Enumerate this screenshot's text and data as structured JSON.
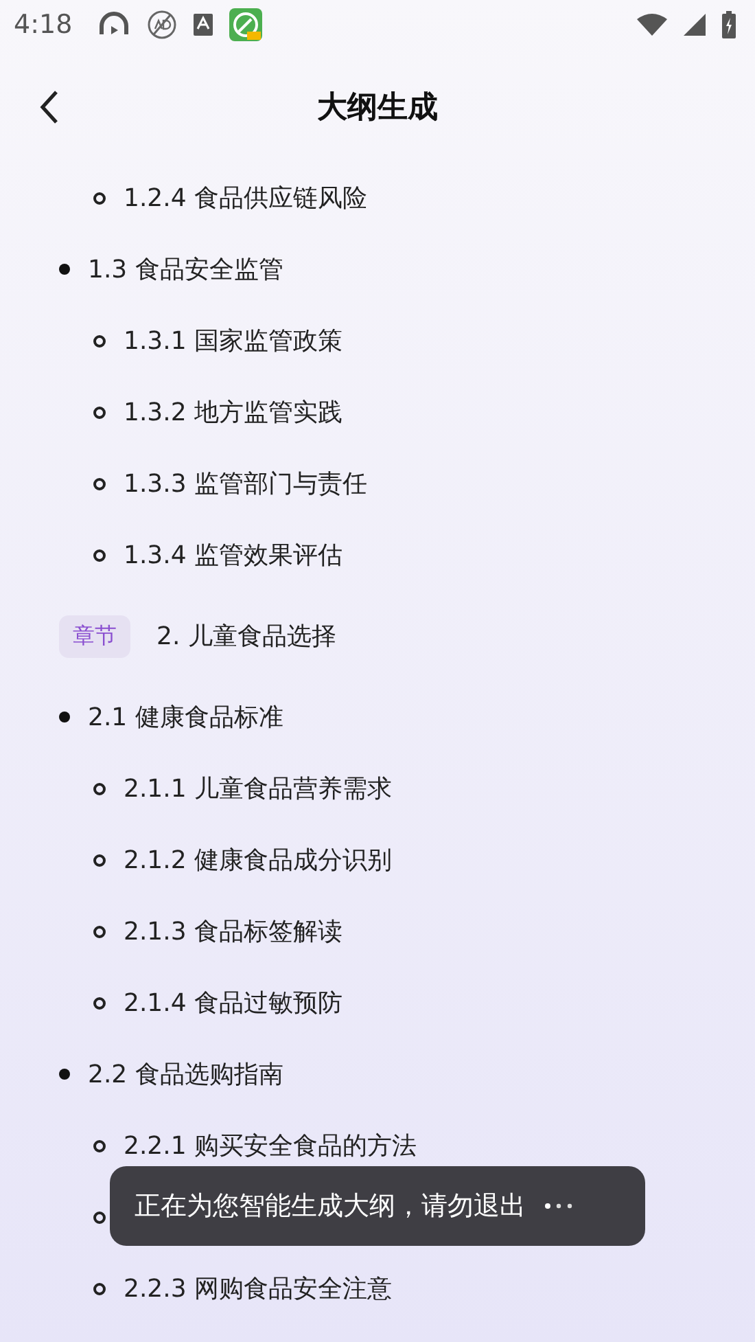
{
  "status_bar": {
    "time": "4:18"
  },
  "header": {
    "title": "大纲生成"
  },
  "outline": [
    {
      "children": [
        {
          "children": [
            {
              "text": "1.2.4 食品供应链风险"
            }
          ]
        },
        {
          "text": "1.3 食品安全监管",
          "children": [
            {
              "text": "1.3.1 国家监管政策"
            },
            {
              "text": "1.3.2 地方监管实践"
            },
            {
              "text": "1.3.3 监管部门与责任"
            },
            {
              "text": "1.3.4 监管效果评估"
            }
          ]
        }
      ]
    },
    {
      "tag": "章节",
      "text": "2. 儿童食品选择",
      "children": [
        {
          "text": "2.1 健康食品标准",
          "children": [
            {
              "text": "2.1.1 儿童食品营养需求"
            },
            {
              "text": "2.1.2 健康食品成分识别"
            },
            {
              "text": "2.1.3 食品标签解读"
            },
            {
              "text": "2.1.4 食品过敏预防"
            }
          ]
        },
        {
          "text": "2.2 食品选购指南",
          "children": [
            {
              "text": "2.2.1 购买安全食品的方法",
              "covered": false
            },
            {
              "covered": true
            },
            {
              "text": "2.2.3 网购食品安全注意",
              "covered": false
            }
          ]
        }
      ]
    }
  ],
  "toast": {
    "text": "正在为您智能生成大纲，请勿退出"
  }
}
